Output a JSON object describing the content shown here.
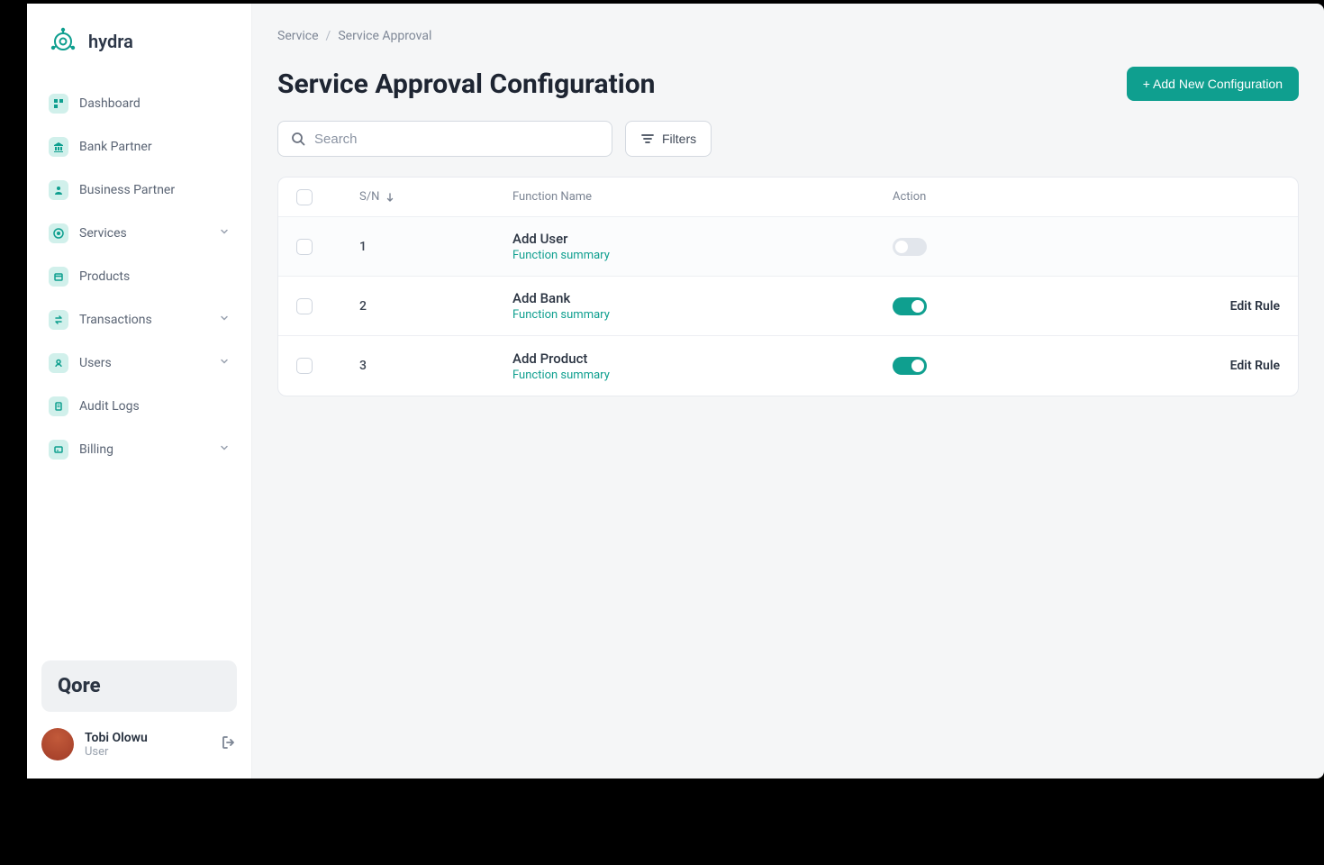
{
  "brand": {
    "name": "hydra",
    "secondary_brand": "Qore"
  },
  "sidebar": {
    "items": [
      {
        "label": "Dashboard",
        "expandable": false
      },
      {
        "label": "Bank Partner",
        "expandable": false
      },
      {
        "label": "Business Partner",
        "expandable": false
      },
      {
        "label": "Services",
        "expandable": true
      },
      {
        "label": "Products",
        "expandable": false
      },
      {
        "label": "Transactions",
        "expandable": true
      },
      {
        "label": "Users",
        "expandable": true
      },
      {
        "label": "Audit Logs",
        "expandable": false
      },
      {
        "label": "Billing",
        "expandable": true
      }
    ]
  },
  "user": {
    "name": "Tobi Olowu",
    "role": "User"
  },
  "breadcrumb": {
    "root": "Service",
    "current": "Service Approval"
  },
  "page": {
    "title": "Service Approval Configuration",
    "add_button": "+ Add New Configuration"
  },
  "search": {
    "placeholder": "Search"
  },
  "filters": {
    "label": "Filters"
  },
  "table": {
    "headers": {
      "sn": "S/N",
      "function_name": "Function Name",
      "action": "Action"
    },
    "rows": [
      {
        "sn": "1",
        "name": "Add User",
        "summary": "Function summary",
        "active": false,
        "edit": ""
      },
      {
        "sn": "2",
        "name": "Add Bank",
        "summary": "Function summary",
        "active": true,
        "edit": "Edit Rule"
      },
      {
        "sn": "3",
        "name": "Add Product",
        "summary": "Function summary",
        "active": true,
        "edit": "Edit Rule"
      }
    ]
  }
}
